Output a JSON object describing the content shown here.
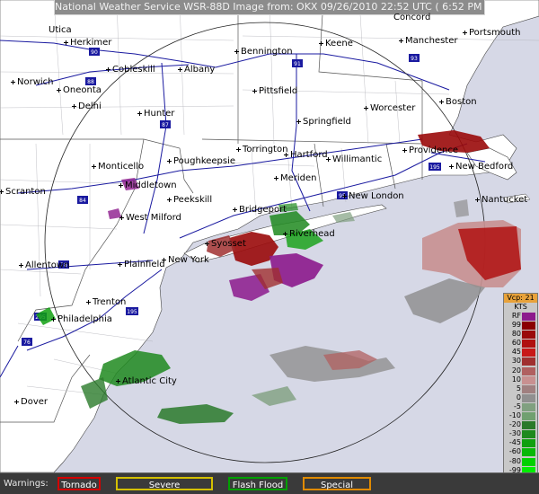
{
  "header": {
    "title": "National Weather Service WSR-88D Image from: OKX 09/26/2010 22:52 UTC ( 6:52 PM EDT)"
  },
  "cities": [
    {
      "name": "Utica",
      "id": "utica"
    },
    {
      "name": "Herkimer",
      "id": "herkimer"
    },
    {
      "name": "Concord",
      "id": "concord"
    },
    {
      "name": "Portsmouth",
      "id": "portsmouth"
    },
    {
      "name": "Manchester",
      "id": "manchester"
    },
    {
      "name": "Keene",
      "id": "keene"
    },
    {
      "name": "Bennington",
      "id": "bennington"
    },
    {
      "name": "Cobleskill",
      "id": "cobleskill"
    },
    {
      "name": "Albany",
      "id": "albany"
    },
    {
      "name": "Norwich",
      "id": "norwich"
    },
    {
      "name": "Oneonta",
      "id": "oneonta"
    },
    {
      "name": "Delhi",
      "id": "delhi"
    },
    {
      "name": "Pittsfield",
      "id": "pittsfield"
    },
    {
      "name": "Worcester",
      "id": "worcester"
    },
    {
      "name": "Boston",
      "id": "boston"
    },
    {
      "name": "Hunter",
      "id": "hunter"
    },
    {
      "name": "Springfield",
      "id": "springfield"
    },
    {
      "name": "Torrington",
      "id": "torrington"
    },
    {
      "name": "Hartford",
      "id": "hartford"
    },
    {
      "name": "Willimantic",
      "id": "willimantic"
    },
    {
      "name": "Providence",
      "id": "providence"
    },
    {
      "name": "New Bedford",
      "id": "new-bedford"
    },
    {
      "name": "Monticello",
      "id": "monticello"
    },
    {
      "name": "Poughkeepsie",
      "id": "poughkeepsie"
    },
    {
      "name": "Meriden",
      "id": "meriden"
    },
    {
      "name": "Scranton",
      "id": "scranton"
    },
    {
      "name": "Middletown",
      "id": "middletown"
    },
    {
      "name": "Peekskill",
      "id": "peekskill"
    },
    {
      "name": "New London",
      "id": "new-london"
    },
    {
      "name": "Nantucket",
      "id": "nantucket"
    },
    {
      "name": "Bridgeport",
      "id": "bridgeport"
    },
    {
      "name": "West Milford",
      "id": "west-milford"
    },
    {
      "name": "Riverhead",
      "id": "riverhead"
    },
    {
      "name": "Syosset",
      "id": "syosset"
    },
    {
      "name": "Allentown",
      "id": "allentown"
    },
    {
      "name": "Plainfield",
      "id": "plainfield"
    },
    {
      "name": "New York",
      "id": "new-york"
    },
    {
      "name": "Trenton",
      "id": "trenton"
    },
    {
      "name": "Philadelphia",
      "id": "philadelphia"
    },
    {
      "name": "Atlantic City",
      "id": "atlantic-city"
    },
    {
      "name": "Dover",
      "id": "dover"
    }
  ],
  "highways": [
    "90",
    "88",
    "91",
    "93",
    "87",
    "84",
    "95",
    "195",
    "78",
    "76",
    "295",
    "195"
  ],
  "legend": {
    "header": "Vcp: 21",
    "unit": "KTS",
    "rows": [
      {
        "label": "RF",
        "color": "#8c1a8c"
      },
      {
        "label": "99",
        "color": "#8a0000"
      },
      {
        "label": "80",
        "color": "#9a0a0a"
      },
      {
        "label": "60",
        "color": "#b01010"
      },
      {
        "label": "45",
        "color": "#c81818"
      },
      {
        "label": "30",
        "color": "#a03030"
      },
      {
        "label": "20",
        "color": "#b06060"
      },
      {
        "label": "10",
        "color": "#c89090"
      },
      {
        "label": "5",
        "color": "#a08080"
      },
      {
        "label": "0",
        "color": "#909090"
      },
      {
        "label": "-5",
        "color": "#80a080"
      },
      {
        "label": "-10",
        "color": "#70a070"
      },
      {
        "label": "-20",
        "color": "#2a7a2a"
      },
      {
        "label": "-30",
        "color": "#1e8a1e"
      },
      {
        "label": "-45",
        "color": "#10a010"
      },
      {
        "label": "-60",
        "color": "#08b808"
      },
      {
        "label": "-80",
        "color": "#00d000"
      },
      {
        "label": "-99",
        "color": "#00ee00"
      },
      {
        "label": "ND",
        "color": "#7a7a7a"
      }
    ]
  },
  "warnings": {
    "label": "Warnings:",
    "items": [
      {
        "label": "Tornado",
        "color": "#d40000"
      },
      {
        "label": "Severe Thunderstorm",
        "color": "#d4c000"
      },
      {
        "label": "Flash Flood",
        "color": "#00a000"
      },
      {
        "label": "Special Marine",
        "color": "#e08a00"
      }
    ]
  }
}
